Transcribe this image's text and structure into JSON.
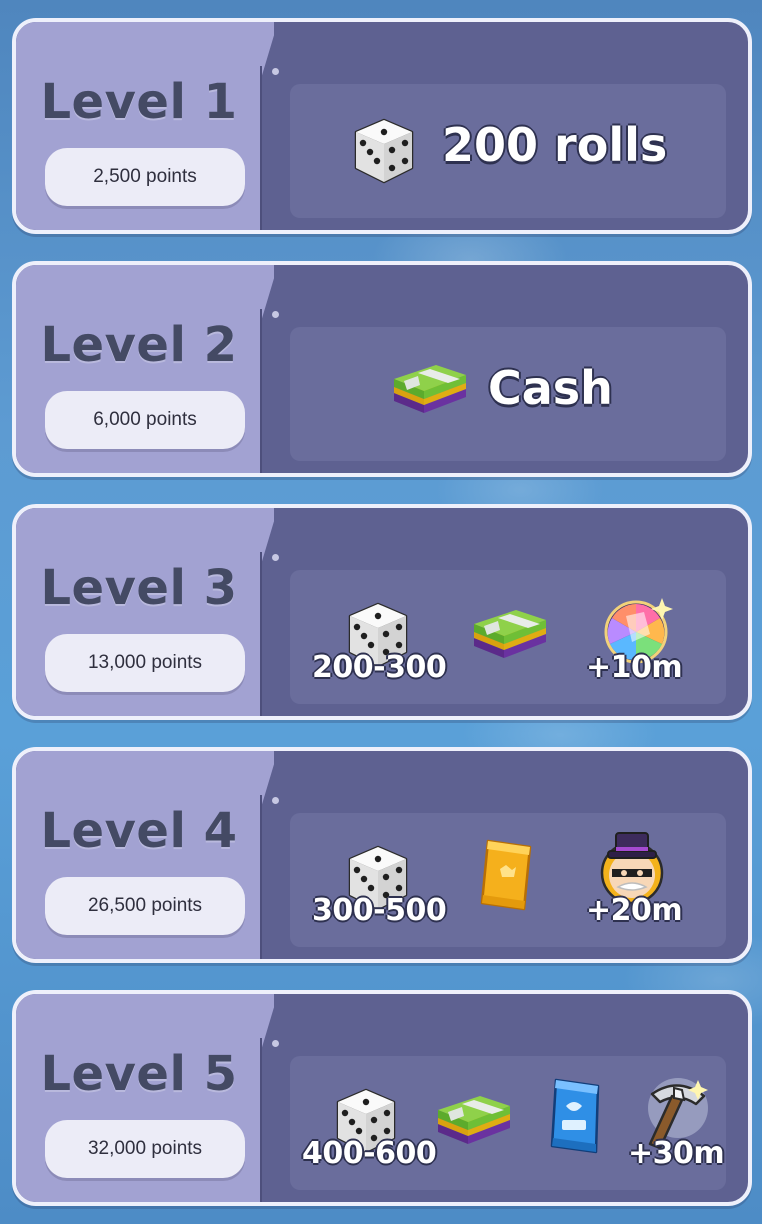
{
  "levels": [
    {
      "title": "Level 1",
      "points": "2,500 points",
      "reward_main": "200 rolls"
    },
    {
      "title": "Level 2",
      "points": "6,000 points",
      "reward_main": "Cash"
    },
    {
      "title": "Level 3",
      "points": "13,000 points",
      "dice_range": "200-300",
      "bonus": "+10m"
    },
    {
      "title": "Level 4",
      "points": "26,500 points",
      "dice_range": "300-500",
      "bonus": "+20m"
    },
    {
      "title": "Level 5",
      "points": "32,000 points",
      "dice_range": "400-600",
      "bonus": "+30m"
    }
  ],
  "icons": {
    "dice": "dice-icon",
    "cash": "cash-stack-icon",
    "sticker_pack_gold": "sticker-pack-gold-icon",
    "sticker_pack_blue": "sticker-pack-blue-icon",
    "prism_boost": "prism-boost-icon",
    "mr_monopoly": "mr-monopoly-icon",
    "pickaxe": "pickaxe-icon"
  },
  "colors": {
    "background": "#5a9bd3",
    "card_left": "#a2a2d2",
    "card_right": "#5e6191",
    "title_text": "#444a64"
  }
}
